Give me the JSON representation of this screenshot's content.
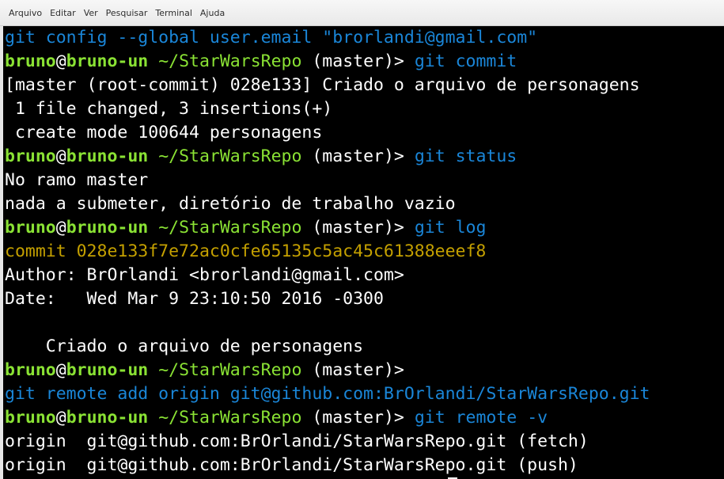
{
  "menu": {
    "items": [
      "Arquivo",
      "Editar",
      "Ver",
      "Pesquisar",
      "Terminal",
      "Ajuda"
    ]
  },
  "terminal": {
    "colors": {
      "background": "#000000",
      "prompt_user": "#8ae234",
      "command": "#1a86d8",
      "commit_hash": "#c4a000",
      "text": "#ffffff"
    },
    "lines": [
      {
        "type": "cmd",
        "text": "git config --global user.email \"brorlandi@gmail.com\""
      },
      {
        "type": "prompt",
        "user": "bruno",
        "at": "@",
        "host": "bruno-un",
        "path": " ~/StarWarsRepo",
        "branch": " (master)> ",
        "command": "git commit"
      },
      {
        "type": "out",
        "text": "[master (root-commit) 028e133] Criado o arquivo de personagens"
      },
      {
        "type": "out",
        "text": " 1 file changed, 3 insertions(+)"
      },
      {
        "type": "out",
        "text": " create mode 100644 personagens"
      },
      {
        "type": "prompt",
        "user": "bruno",
        "at": "@",
        "host": "bruno-un",
        "path": " ~/StarWarsRepo",
        "branch": " (master)> ",
        "command": "git status"
      },
      {
        "type": "out",
        "text": "No ramo master"
      },
      {
        "type": "out",
        "text": "nada a submeter, diretório de trabalho vazio"
      },
      {
        "type": "prompt",
        "user": "bruno",
        "at": "@",
        "host": "bruno-un",
        "path": " ~/StarWarsRepo",
        "branch": " (master)> ",
        "command": "git log"
      },
      {
        "type": "hash",
        "text": "commit 028e133f7e72ac0cfe65135c5ac45c61388eeef8"
      },
      {
        "type": "out",
        "text": "Author: BrOrlandi <brorlandi@gmail.com>"
      },
      {
        "type": "out",
        "text": "Date:   Wed Mar 9 23:10:50 2016 -0300"
      },
      {
        "type": "out",
        "text": ""
      },
      {
        "type": "out",
        "text": "    Criado o arquivo de personagens"
      },
      {
        "type": "prompt",
        "user": "bruno",
        "at": "@",
        "host": "bruno-un",
        "path": " ~/StarWarsRepo",
        "branch": " (master)>",
        "command": ""
      },
      {
        "type": "cmd",
        "text": "git remote add origin git@github.com:BrOrlandi/StarWarsRepo.git"
      },
      {
        "type": "prompt",
        "user": "bruno",
        "at": "@",
        "host": "bruno-un",
        "path": " ~/StarWarsRepo",
        "branch": " (master)> ",
        "command": "git remote -v"
      },
      {
        "type": "out",
        "text": "origin  git@github.com:BrOrlandi/StarWarsRepo.git (fetch)"
      },
      {
        "type": "out",
        "text": "origin  git@github.com:BrOrlandi/StarWarsRepo.git (push)"
      }
    ]
  }
}
